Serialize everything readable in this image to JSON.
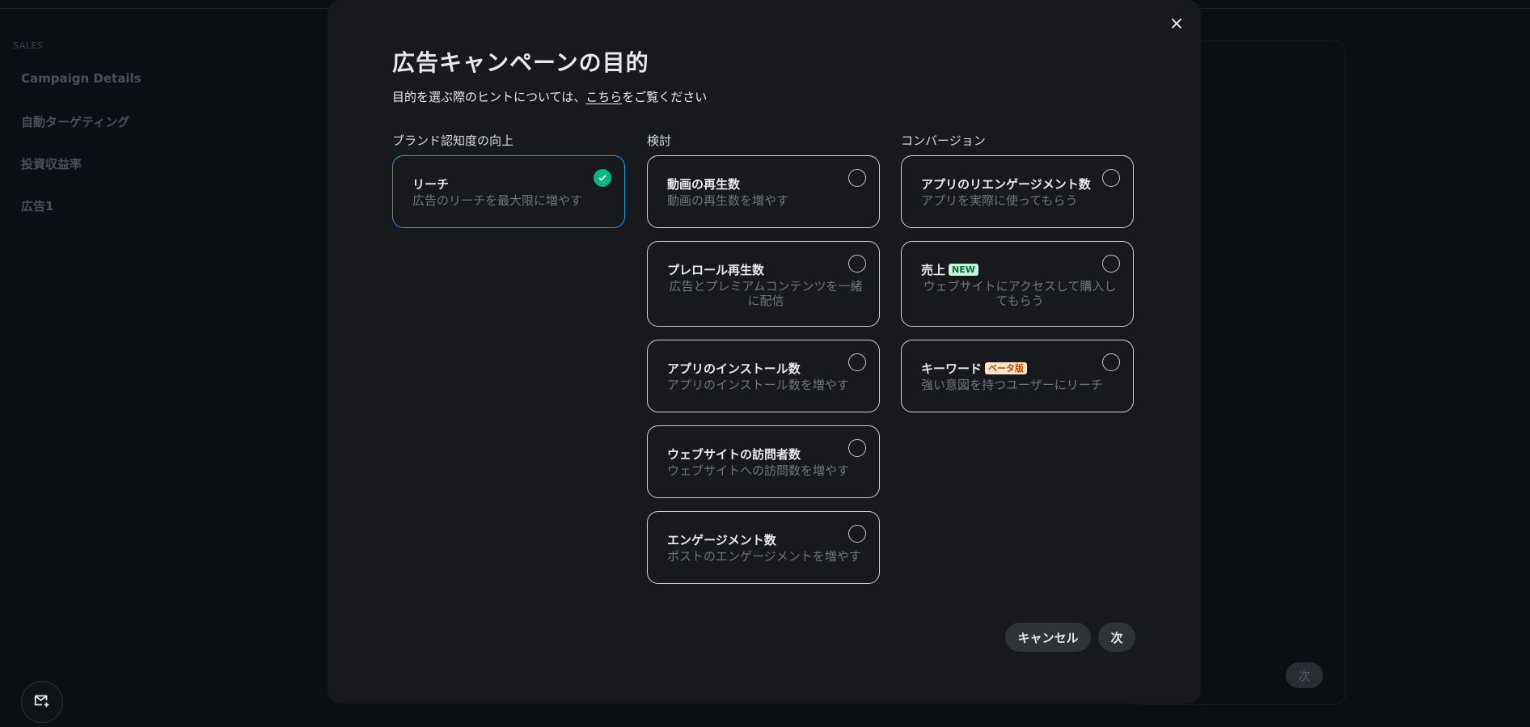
{
  "sidebar": {
    "section": "SALES",
    "items": [
      "Campaign Details",
      "自動ターゲティング",
      "投資収益率",
      "広告1"
    ]
  },
  "background": {
    "next_label": "次"
  },
  "modal": {
    "title": "広告キャンペーンの目的",
    "subtitle_prefix": "目的を選ぶ際のヒントについては、",
    "subtitle_link": "こちら",
    "subtitle_suffix": "をご覧ください",
    "close_icon": "×",
    "columns": [
      {
        "header": "ブランド認知度の向上"
      },
      {
        "header": "検討"
      },
      {
        "header": "コンバージョン"
      }
    ],
    "options": {
      "reach": {
        "title": "リーチ",
        "desc": "広告のリーチを最大限に増やす",
        "selected": true
      },
      "video_views": {
        "title": "動画の再生数",
        "desc": "動画の再生数を増やす"
      },
      "preroll": {
        "title": "プレロール再生数",
        "desc": "広告とプレミアムコンテンツを一緒に配信"
      },
      "app_installs": {
        "title": "アプリのインストール数",
        "desc": "アプリのインストール数を増やす"
      },
      "website_visits": {
        "title": "ウェブサイトの訪問者数",
        "desc": "ウェブサイトへの訪問数を増やす"
      },
      "engagements": {
        "title": "エンゲージメント数",
        "desc": "ポストのエンゲージメントを増やす"
      },
      "app_reengagement": {
        "title": "アプリのリエンゲージメント数",
        "desc": "アプリを実際に使ってもらう"
      },
      "sales": {
        "title": "売上",
        "badge": "NEW",
        "desc": "ウェブサイトにアクセスして購入してもらう"
      },
      "keywords": {
        "title": "キーワード",
        "badge": "ベータ版",
        "desc": "強い意図を持つユーザーにリーチ"
      }
    },
    "cancel_label": "キャンセル",
    "next_label": "次"
  },
  "colors": {
    "accent": "#1d9bf0",
    "check": "#00ba7c",
    "modal_bg": "#17191c"
  }
}
